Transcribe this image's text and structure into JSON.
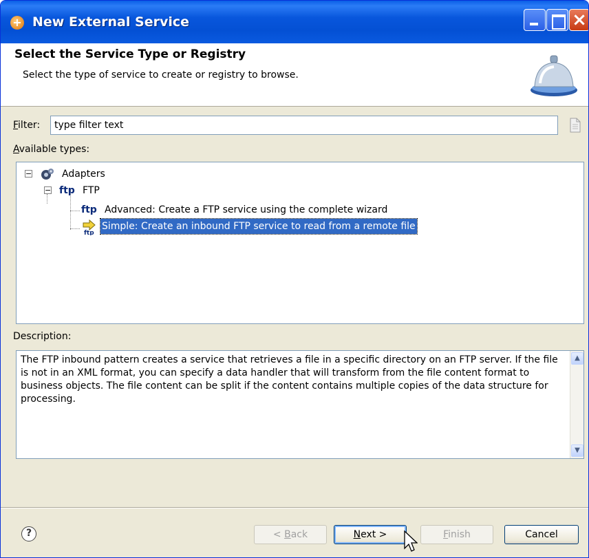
{
  "window": {
    "title": "New External Service"
  },
  "header": {
    "title": "Select the Service Type or Registry",
    "description": "Select the type of service to create or registry to browse."
  },
  "filter": {
    "label_accel": "F",
    "label_rest": "ilter:",
    "value": "type filter text"
  },
  "available_types": {
    "label_accel": "A",
    "label_rest": "vailable types:",
    "tree": {
      "adapters": "Adapters",
      "ftp": "FTP",
      "ftp_icon": "ftp",
      "advanced": "Advanced: Create a FTP service using the complete wizard",
      "simple": "Simple: Create an inbound FTP service to read from a remote file"
    }
  },
  "description": {
    "label": "Description:",
    "text": "The FTP inbound pattern creates a service that retrieves a file in a specific directory on an FTP server. If the file is not in an XML format, you can specify a data handler that will transform from the file content format to business objects. The file content can be split if the content contains multiple copies of the data structure for processing."
  },
  "buttons": {
    "back_prefix": "< ",
    "back_accel": "B",
    "back_rest": "ack",
    "next_accel": "N",
    "next_rest": "ext >",
    "finish_accel": "F",
    "finish_rest": "inish",
    "cancel": "Cancel"
  },
  "icons": {
    "help": "?",
    "close": "×"
  }
}
